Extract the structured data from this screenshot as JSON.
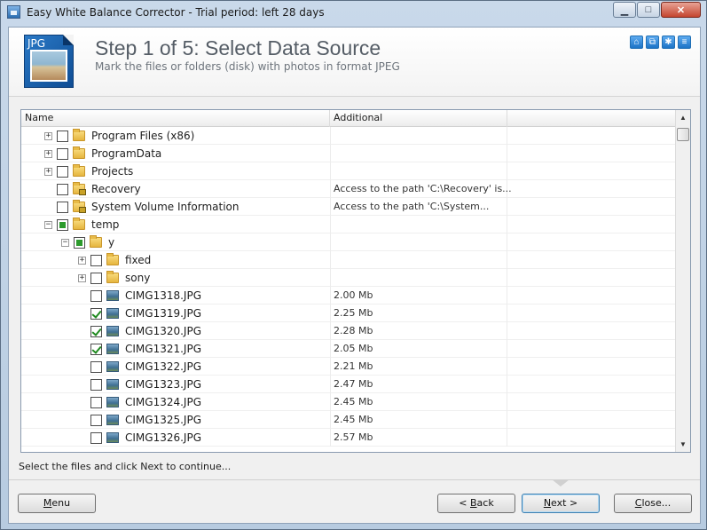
{
  "window": {
    "title": "Easy White Balance Corrector - Trial period: left 28 days",
    "controls": {
      "minimize": "▁",
      "maximize": "□",
      "close": "✕"
    }
  },
  "header": {
    "logo_text": "JPG",
    "title": "Step 1 of 5: Select Data Source",
    "subtitle": "Mark the files or folders (disk) with photos in format JPEG",
    "icons": [
      "home-icon",
      "network-icon",
      "settings-icon",
      "info-icon"
    ]
  },
  "grid": {
    "columns": [
      "Name",
      "Additional"
    ],
    "rows": [
      {
        "name": "Program Files (x86)",
        "additional": "",
        "indent": 0,
        "expander": "+",
        "check": "off",
        "icon": "folder"
      },
      {
        "name": "ProgramData",
        "additional": "",
        "indent": 0,
        "expander": "+",
        "check": "off",
        "icon": "folder"
      },
      {
        "name": "Projects",
        "additional": "",
        "indent": 0,
        "expander": "+",
        "check": "off",
        "icon": "folder"
      },
      {
        "name": "Recovery",
        "additional": "Access to the path 'C:\\Recovery' is...",
        "indent": 0,
        "expander": "",
        "check": "off",
        "icon": "folder-locked"
      },
      {
        "name": "System Volume Information",
        "additional": "Access to the path 'C:\\System...",
        "indent": 0,
        "expander": "",
        "check": "off",
        "icon": "folder-locked"
      },
      {
        "name": "temp",
        "additional": "",
        "indent": 0,
        "expander": "−",
        "check": "partial",
        "icon": "folder"
      },
      {
        "name": "y",
        "additional": "",
        "indent": 1,
        "expander": "−",
        "check": "partial",
        "icon": "folder"
      },
      {
        "name": "fixed",
        "additional": "",
        "indent": 2,
        "expander": "+",
        "check": "off",
        "icon": "folder"
      },
      {
        "name": "sony",
        "additional": "",
        "indent": 2,
        "expander": "+",
        "check": "off",
        "icon": "folder"
      },
      {
        "name": "CIMG1318.JPG",
        "additional": "2.00 Mb",
        "indent": 2,
        "expander": "",
        "check": "off",
        "icon": "image"
      },
      {
        "name": "CIMG1319.JPG",
        "additional": "2.25 Mb",
        "indent": 2,
        "expander": "",
        "check": "on",
        "icon": "image"
      },
      {
        "name": "CIMG1320.JPG",
        "additional": "2.28 Mb",
        "indent": 2,
        "expander": "",
        "check": "on",
        "icon": "image"
      },
      {
        "name": "CIMG1321.JPG",
        "additional": "2.05 Mb",
        "indent": 2,
        "expander": "",
        "check": "on",
        "icon": "image"
      },
      {
        "name": "CIMG1322.JPG",
        "additional": "2.21 Mb",
        "indent": 2,
        "expander": "",
        "check": "off",
        "icon": "image"
      },
      {
        "name": "CIMG1323.JPG",
        "additional": "2.47 Mb",
        "indent": 2,
        "expander": "",
        "check": "off",
        "icon": "image"
      },
      {
        "name": "CIMG1324.JPG",
        "additional": "2.45 Mb",
        "indent": 2,
        "expander": "",
        "check": "off",
        "icon": "image"
      },
      {
        "name": "CIMG1325.JPG",
        "additional": "2.45 Mb",
        "indent": 2,
        "expander": "",
        "check": "off",
        "icon": "image"
      },
      {
        "name": "CIMG1326.JPG",
        "additional": "2.57 Mb",
        "indent": 2,
        "expander": "",
        "check": "off",
        "icon": "image"
      }
    ]
  },
  "status": {
    "text": "Select the files and click Next to continue..."
  },
  "buttons": {
    "menu": {
      "pre": "",
      "u": "M",
      "post": "enu"
    },
    "back": {
      "pre": "< ",
      "u": "B",
      "post": "ack"
    },
    "next": {
      "pre": "",
      "u": "N",
      "post": "ext >"
    },
    "close": {
      "pre": "",
      "u": "C",
      "post": "lose..."
    }
  },
  "scrollbar": {
    "up": "▲",
    "down": "▼"
  }
}
